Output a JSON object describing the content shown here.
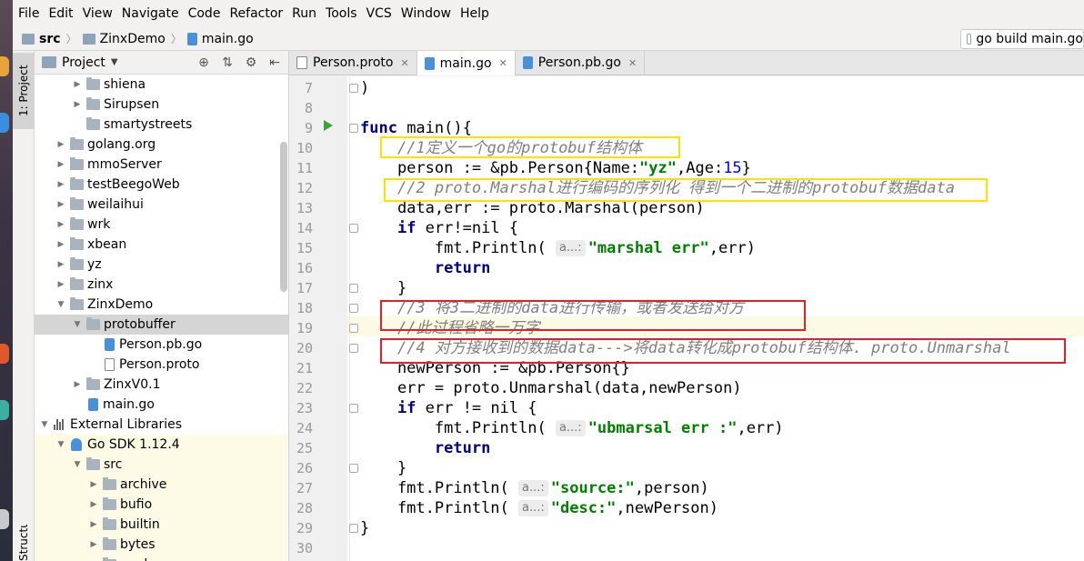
{
  "menu": [
    "File",
    "Edit",
    "View",
    "Navigate",
    "Code",
    "Refactor",
    "Run",
    "Tools",
    "VCS",
    "Window",
    "Help"
  ],
  "breadcrumb": [
    "src",
    "ZinxDemo",
    "main.go"
  ],
  "run_config": "go build main.go",
  "tool_windows": {
    "project": "1: Project",
    "structure": "Structure"
  },
  "project_panel": {
    "title": "Project"
  },
  "tree": [
    {
      "label": "shiena",
      "indent": 2,
      "arrow": "▶",
      "icon": "folder"
    },
    {
      "label": "Sirupsen",
      "indent": 2,
      "arrow": "▶",
      "icon": "folder"
    },
    {
      "label": "smartystreets",
      "indent": 2,
      "arrow": "",
      "icon": "folder"
    },
    {
      "label": "golang.org",
      "indent": 1,
      "arrow": "▶",
      "icon": "folder"
    },
    {
      "label": "mmoServer",
      "indent": 1,
      "arrow": "▶",
      "icon": "folder"
    },
    {
      "label": "testBeegoWeb",
      "indent": 1,
      "arrow": "▶",
      "icon": "folder"
    },
    {
      "label": "weilaihui",
      "indent": 1,
      "arrow": "▶",
      "icon": "folder"
    },
    {
      "label": "wrk",
      "indent": 1,
      "arrow": "▶",
      "icon": "folder"
    },
    {
      "label": "xbean",
      "indent": 1,
      "arrow": "▶",
      "icon": "folder"
    },
    {
      "label": "yz",
      "indent": 1,
      "arrow": "▶",
      "icon": "folder"
    },
    {
      "label": "zinx",
      "indent": 1,
      "arrow": "▶",
      "icon": "folder"
    },
    {
      "label": "ZinxDemo",
      "indent": 1,
      "arrow": "▼",
      "icon": "folder"
    },
    {
      "label": "protobuffer",
      "indent": 2,
      "arrow": "▼",
      "icon": "folder",
      "selected": true
    },
    {
      "label": "Person.pb.go",
      "indent": 3,
      "arrow": "",
      "icon": "gofile"
    },
    {
      "label": "Person.proto",
      "indent": 3,
      "arrow": "",
      "icon": "protofile"
    },
    {
      "label": "ZinxV0.1",
      "indent": 2,
      "arrow": "▶",
      "icon": "folder"
    },
    {
      "label": "main.go",
      "indent": 2,
      "arrow": "",
      "icon": "gofile"
    },
    {
      "label": "External Libraries",
      "indent": 0,
      "arrow": "▼",
      "icon": "lib"
    },
    {
      "label": "Go SDK 1.12.4",
      "indent": 1,
      "arrow": "▼",
      "icon": "sdk",
      "yellow": true
    },
    {
      "label": "src",
      "indent": 2,
      "arrow": "▼",
      "icon": "folder",
      "yellow": true
    },
    {
      "label": "archive",
      "indent": 3,
      "arrow": "▶",
      "icon": "folder",
      "yellow": true
    },
    {
      "label": "bufio",
      "indent": 3,
      "arrow": "▶",
      "icon": "folder",
      "yellow": true
    },
    {
      "label": "builtin",
      "indent": 3,
      "arrow": "▶",
      "icon": "folder",
      "yellow": true
    },
    {
      "label": "bytes",
      "indent": 3,
      "arrow": "▶",
      "icon": "folder",
      "yellow": true
    },
    {
      "label": "cmd",
      "indent": 3,
      "arrow": "▶",
      "icon": "folder",
      "yellow": true
    }
  ],
  "tabs": [
    {
      "label": "Person.proto",
      "icon": "proto",
      "active": false
    },
    {
      "label": "main.go",
      "icon": "go",
      "active": true
    },
    {
      "label": "Person.pb.go",
      "icon": "pb",
      "active": false
    }
  ],
  "code_lines": [
    {
      "n": "7",
      "html": ")"
    },
    {
      "n": "8",
      "html": ""
    },
    {
      "n": "9",
      "html": "<span class=\"kw\">func</span> main(){"
    },
    {
      "n": "10",
      "html": "    <span class=\"cm\">//1定义一个go的protobuf结构体</span>"
    },
    {
      "n": "11",
      "html": "    person := &amp;pb.Person{Name:<span class=\"str\">\"yz\"</span>,Age:<span class=\"num\">15</span>}"
    },
    {
      "n": "12",
      "html": "    <span class=\"cm\">//2 proto.Marshal进行编码的序列化 得到一个二进制的protobuf数据data</span>"
    },
    {
      "n": "13",
      "html": "    data,err := proto.Marshal(person)"
    },
    {
      "n": "14",
      "html": "    <span class=\"kw\">if</span> err!=nil {"
    },
    {
      "n": "15",
      "html": "        fmt.Println( <span class=\"hint\">a...:</span><span class=\"str\">\"marshal err\"</span>,err)"
    },
    {
      "n": "16",
      "html": "        <span class=\"kw\">return</span>"
    },
    {
      "n": "17",
      "html": "    }"
    },
    {
      "n": "18",
      "html": "    <span class=\"cm\">//3 将3二进制的data进行传输，或者发送给对方</span>"
    },
    {
      "n": "19",
      "html": "    <span class=\"cm\">//此过程省略一万字</span>"
    },
    {
      "n": "20",
      "html": "    <span class=\"cm\">//4 对方接收到的数据data--->将data转化成protobuf结构体. proto.Unmarshal</span>"
    },
    {
      "n": "21",
      "html": "    newPerson := &amp;pb.Person{}"
    },
    {
      "n": "22",
      "html": "    err = proto.Unmarshal(data,newPerson)"
    },
    {
      "n": "23",
      "html": "    <span class=\"kw\">if</span> err != nil {"
    },
    {
      "n": "24",
      "html": "        fmt.Println( <span class=\"hint\">a...:</span><span class=\"str\">\"ubmarsal err :\"</span>,err)"
    },
    {
      "n": "25",
      "html": "        <span class=\"kw\">return</span>"
    },
    {
      "n": "26",
      "html": "    }"
    },
    {
      "n": "27",
      "html": "    fmt.Println( <span class=\"hint\">a...:</span><span class=\"str\">\"source:\"</span>,person)"
    },
    {
      "n": "28",
      "html": "    fmt.Println( <span class=\"hint\">a...:</span><span class=\"str\">\"desc:\"</span>,newPerson)"
    },
    {
      "n": "29",
      "html": "}"
    },
    {
      "n": "30",
      "html": ""
    }
  ],
  "colors": {
    "keyword": "#000080",
    "comment": "#808080",
    "string": "#008000",
    "number": "#0000ff",
    "yellow_box": "#f5e500",
    "red_box": "#e0202a"
  }
}
